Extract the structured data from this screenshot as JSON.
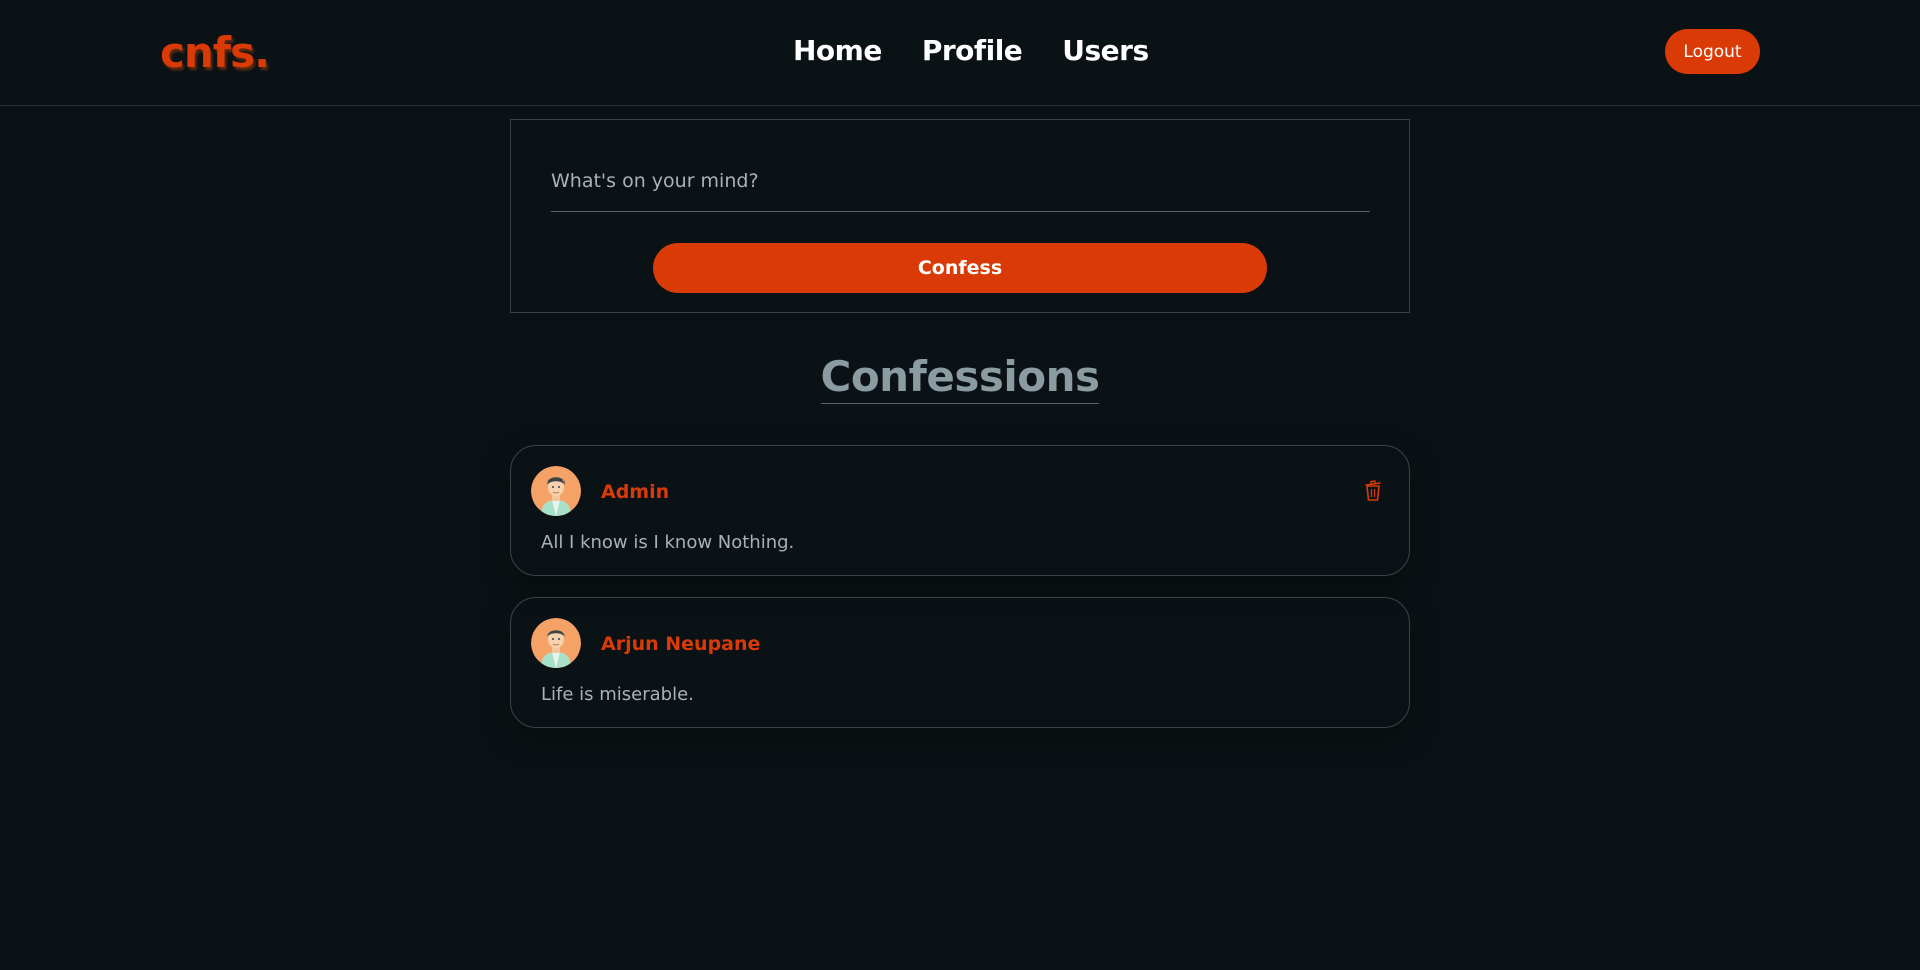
{
  "nav": {
    "logo": "cnfs.",
    "links": [
      "Home",
      "Profile",
      "Users"
    ],
    "logout_label": "Logout"
  },
  "compose": {
    "placeholder": "What's on your mind?",
    "button_label": "Confess"
  },
  "feed": {
    "title": "Confessions",
    "posts": [
      {
        "author": "Admin",
        "text": "All I know is I know Nothing.",
        "avatar_icon": "user-avatar-icon",
        "has_delete": true
      },
      {
        "author": "Arjun Neupane",
        "text": "Life is miserable.",
        "avatar_icon": "user-avatar-icon",
        "has_delete": false
      }
    ]
  },
  "colors": {
    "background": "#0b1215",
    "accent": "#d93a06",
    "muted_text": "#a8b2b6",
    "heading_muted": "#8a9ca2"
  }
}
